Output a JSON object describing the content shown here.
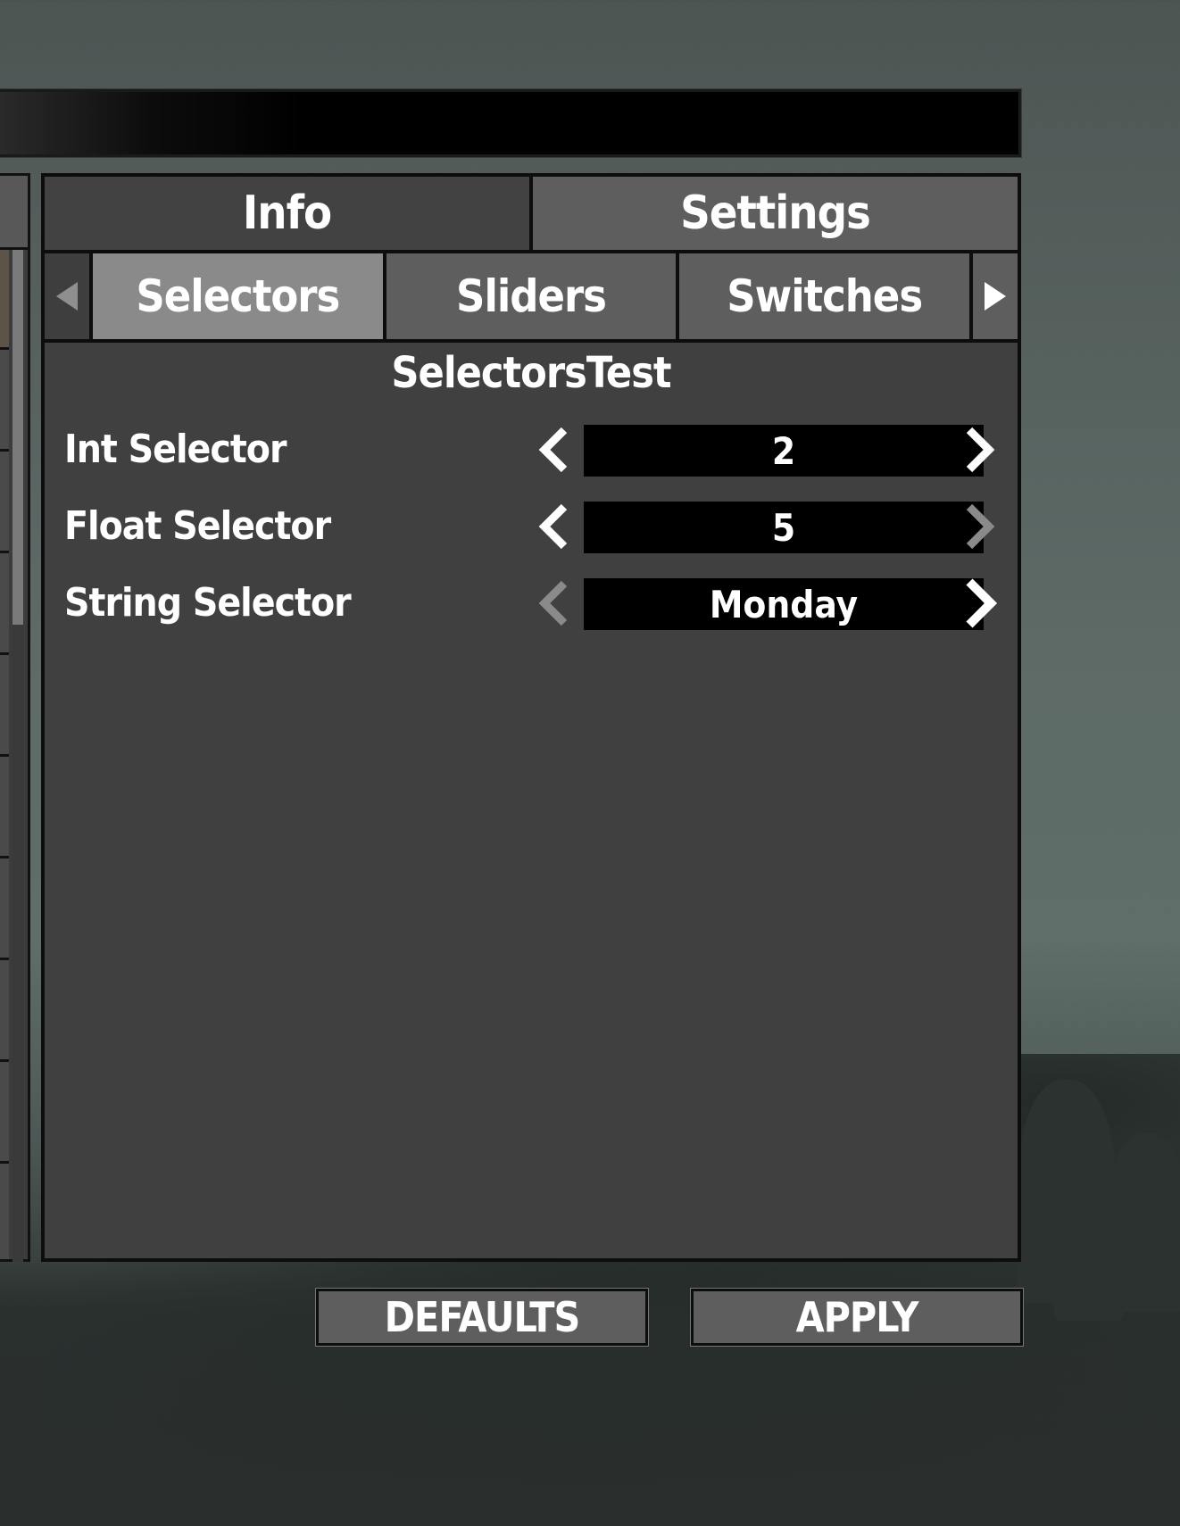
{
  "tabs_top": [
    {
      "label": "Info",
      "active": false
    },
    {
      "label": "Settings",
      "active": true
    }
  ],
  "tabs_sub": [
    {
      "label": "Selectors",
      "active": true
    },
    {
      "label": "Sliders",
      "active": false
    },
    {
      "label": "Switches",
      "active": false
    }
  ],
  "section_title": "SelectorsTest",
  "settings": [
    {
      "label": "Int Selector",
      "value": "2",
      "prev_enabled": true,
      "next_enabled": true
    },
    {
      "label": "Float Selector",
      "value": "5",
      "prev_enabled": true,
      "next_enabled": false
    },
    {
      "label": "String Selector",
      "value": "Monday",
      "prev_enabled": false,
      "next_enabled": true
    }
  ],
  "buttons": {
    "defaults": "DEFAULTS",
    "apply": "APPLY"
  },
  "icons": {
    "sub_prev": "triangle-left-icon",
    "sub_next": "triangle-right-icon",
    "chevron_prev": "chevron-left-icon",
    "chevron_next": "chevron-right-icon"
  },
  "colors": {
    "panel": "#404040",
    "tab_active": "#8a8a8a",
    "tab_inactive": "#5e5e5e",
    "value_box": "#000000",
    "arrow_enabled": "#ffffff",
    "arrow_disabled": "#8a8a8a"
  }
}
